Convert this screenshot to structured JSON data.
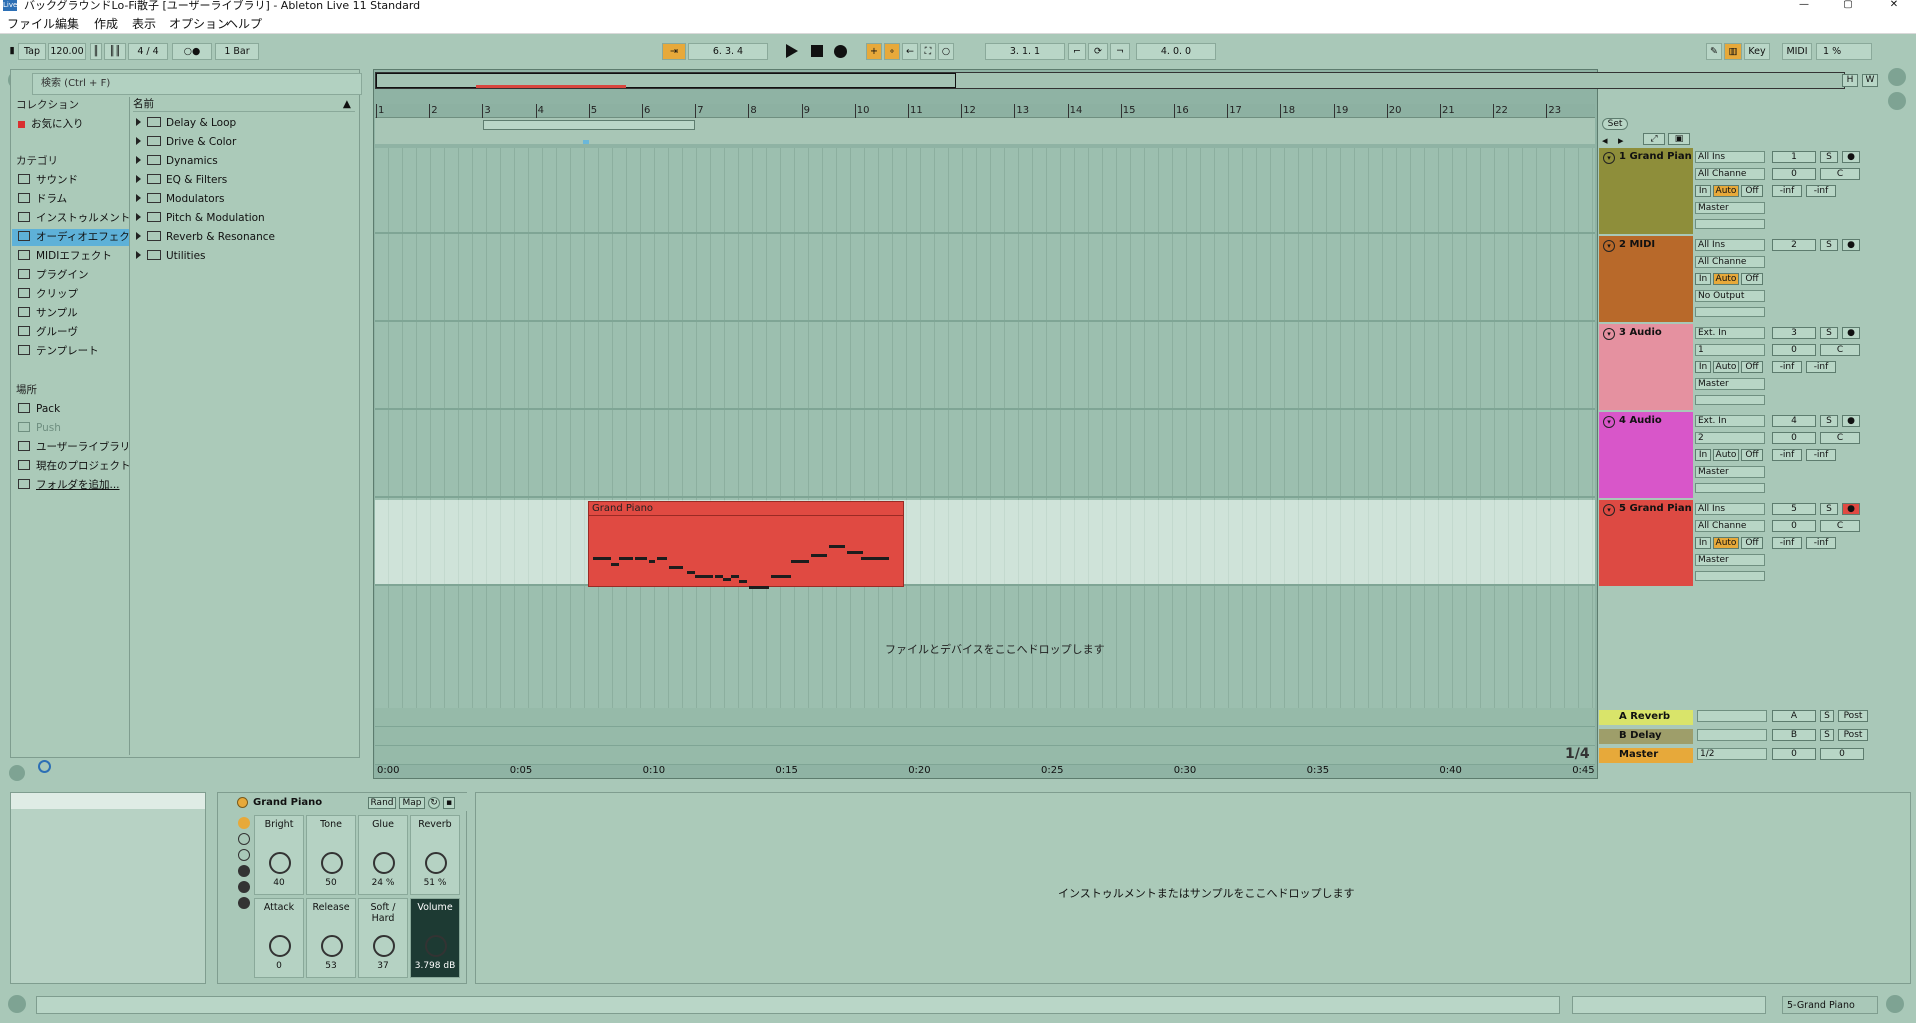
{
  "window": {
    "title": "バックグラウンドLo-Fi散子 [ユーザーライブラリ] - Ableton Live 11 Standard",
    "logo": "Live",
    "min": "—",
    "max": "▢",
    "close": "✕"
  },
  "menu": [
    "ファイル",
    "編集",
    "作成",
    "表示",
    "オプション",
    "ヘルプ"
  ],
  "control_bar": {
    "tap": "Tap",
    "tempo": "120.00",
    "signature": "4 / 4",
    "metronome": "○●",
    "quantize": "1 Bar",
    "follow_icon": "follow-icon",
    "position": "6.  3.  4",
    "loop_start": "3.  1.  1",
    "loop_length": "4.  0.  0",
    "key": "Key",
    "midi": "MIDI",
    "cpu": "1 %"
  },
  "browser": {
    "search_placeholder": "検索 (Ctrl + F)",
    "collections_header": "コレクション",
    "favorites": "お気に入り",
    "categories_header": "カテゴリ",
    "categories": [
      "サウンド",
      "ドラム",
      "インストゥルメント",
      "オーディオエフェクト",
      "MIDIエフェクト",
      "プラグイン",
      "クリップ",
      "サンプル",
      "グルーヴ",
      "テンプレート"
    ],
    "selected_category": "オーディオエフェクト",
    "places_header": "場所",
    "places": [
      "Pack",
      "Push",
      "ユーザーライブラリ",
      "現在のプロジェクト",
      "フォルダを追加..."
    ],
    "name_header": "名前",
    "items": [
      "Delay & Loop",
      "Drive & Color",
      "Dynamics",
      "EQ & Filters",
      "Modulators",
      "Pitch & Modulation",
      "Reverb & Resonance",
      "Utilities"
    ]
  },
  "arrangement": {
    "bars": [
      "1",
      "2",
      "3",
      "4",
      "5",
      "6",
      "7",
      "8",
      "9",
      "10",
      "11",
      "12",
      "13",
      "14",
      "15",
      "16",
      "17",
      "18",
      "19",
      "20",
      "21",
      "22",
      "23"
    ],
    "times": [
      "0:00",
      "0:05",
      "0:10",
      "0:15",
      "0:20",
      "0:25",
      "0:30",
      "0:35",
      "0:40",
      "0:45"
    ],
    "clip_name": "Grand Piano",
    "drop_message": "ファイルとデバイスをここへドロップします",
    "zoom_label": "1/4",
    "set_label": "Set",
    "h_btn": "H",
    "w_btn": "W"
  },
  "tracks": [
    {
      "name": "1 Grand Pian",
      "color": "#8e8e3a",
      "input": "All Ins",
      "channel": "All Channe",
      "output": "Master",
      "num": "1",
      "vol": "0",
      "pan": "C",
      "peak1": "-inf",
      "peak2": "-inf",
      "monitor_active": "Auto"
    },
    {
      "name": "2 MIDI",
      "color": "#b8692a",
      "input": "All Ins",
      "channel": "All Channe",
      "output": "No Output",
      "num": "2",
      "monitor_active": "Auto"
    },
    {
      "name": "3 Audio",
      "color": "#e591a0",
      "input": "Ext. In",
      "channel": "1",
      "output": "Master",
      "num": "3",
      "vol": "0",
      "pan": "C",
      "peak1": "-inf",
      "peak2": "-inf",
      "monitor_active": ""
    },
    {
      "name": "4 Audio",
      "color": "#d856c9",
      "input": "Ext. In",
      "channel": "2",
      "output": "Master",
      "num": "4",
      "vol": "0",
      "pan": "C",
      "peak1": "-inf",
      "peak2": "-inf",
      "monitor_active": ""
    },
    {
      "name": "5 Grand Pian",
      "color": "#dd4a43",
      "input": "All Ins",
      "channel": "All Channe",
      "output": "Master",
      "num": "5",
      "vol": "0",
      "pan": "C",
      "peak1": "-inf",
      "peak2": "-inf",
      "monitor_active": "Auto"
    }
  ],
  "mixer_labels": {
    "in": "In",
    "auto": "Auto",
    "off": "Off",
    "solo": "S",
    "post": "Post"
  },
  "returns": [
    {
      "name": "A Reverb",
      "num": "A",
      "color": "#d9e46a"
    },
    {
      "name": "B Delay",
      "num": "B",
      "color": "#9e9e6a"
    },
    {
      "name": "Master",
      "num": "0",
      "color": "#e7a93a",
      "route": "1/2",
      "master_vol": "0"
    }
  ],
  "device": {
    "name": "Grand Piano",
    "rand": "Rand",
    "map": "Map",
    "knobs": [
      {
        "label": "Bright",
        "value": "40"
      },
      {
        "label": "Tone",
        "value": "50"
      },
      {
        "label": "Glue",
        "value": "24 %"
      },
      {
        "label": "Reverb",
        "value": "51 %"
      },
      {
        "label": "Attack",
        "value": "0"
      },
      {
        "label": "Release",
        "value": "53"
      },
      {
        "label": "Soft / Hard",
        "value": "37"
      },
      {
        "label": "Volume",
        "value": "3.798 dB"
      }
    ],
    "drop_message": "インストゥルメントまたはサンプルをここへドロップします"
  },
  "status": {
    "track": "5-Grand Piano"
  }
}
